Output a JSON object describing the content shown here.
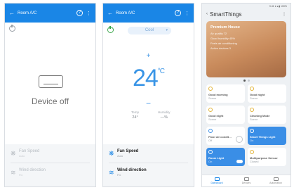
{
  "screen1": {
    "header": {
      "title": "Room A/C",
      "help_label": "?",
      "more_label": "⋮",
      "back_label": "←"
    },
    "device_state": "Device off",
    "controls": [
      {
        "label": "Fan Speed",
        "sub": "Auto",
        "icon": "fan-icon",
        "glyph": "❋"
      },
      {
        "label": "Wind direction",
        "sub": "Fix",
        "icon": "wind-icon",
        "glyph": "≋"
      }
    ]
  },
  "screen2": {
    "header": {
      "title": "Room A/C",
      "help_label": "?",
      "more_label": "⋮",
      "back_label": "←"
    },
    "mode": "Cool",
    "plus_label": "+",
    "minus_label": "−",
    "temperature": "24",
    "unit": "°C",
    "sensors": [
      {
        "label": "Temp",
        "value": "24°"
      },
      {
        "label": "Humidity",
        "value": "—%"
      }
    ],
    "controls": [
      {
        "label": "Fan Speed",
        "sub": "Auto",
        "icon": "fan-icon",
        "glyph": "❋"
      },
      {
        "label": "Wind direction",
        "sub": "Fix",
        "icon": "wind-icon",
        "glyph": "≋"
      }
    ]
  },
  "screen3": {
    "status_bar": "9:41 ▾ ◂ ▮ 100%",
    "back_label": "‹",
    "title": "SmartThings",
    "more_label": "⋮",
    "hero": {
      "title": "Premium House",
      "lines": [
        "Air quality  72",
        "Good humidity  45%",
        "Feels air conditioning",
        "Active devices  3"
      ]
    },
    "tiles": [
      {
        "label": "Good morning",
        "sub": "Scene",
        "style": "plain"
      },
      {
        "label": "Good night",
        "sub": "Scene",
        "style": "plain"
      },
      {
        "label": "Good night",
        "sub": "Scene",
        "style": "plain"
      },
      {
        "label": "Cleaning Mode",
        "sub": "Scene",
        "style": "plain"
      },
      {
        "label": "Floor air condit…",
        "sub": "Off",
        "style": "plain-power"
      },
      {
        "label": "Smart Things Light",
        "sub": "On",
        "style": "blue"
      },
      {
        "label": "Room Light",
        "sub": "On",
        "style": "blue-toggle"
      },
      {
        "label": "Multipurpose Sensor",
        "sub": "Closed",
        "style": "plain"
      }
    ],
    "nav": [
      {
        "label": "Dashboard",
        "active": true
      },
      {
        "label": "Devices",
        "active": false
      },
      {
        "label": "Automation",
        "active": false
      }
    ]
  }
}
